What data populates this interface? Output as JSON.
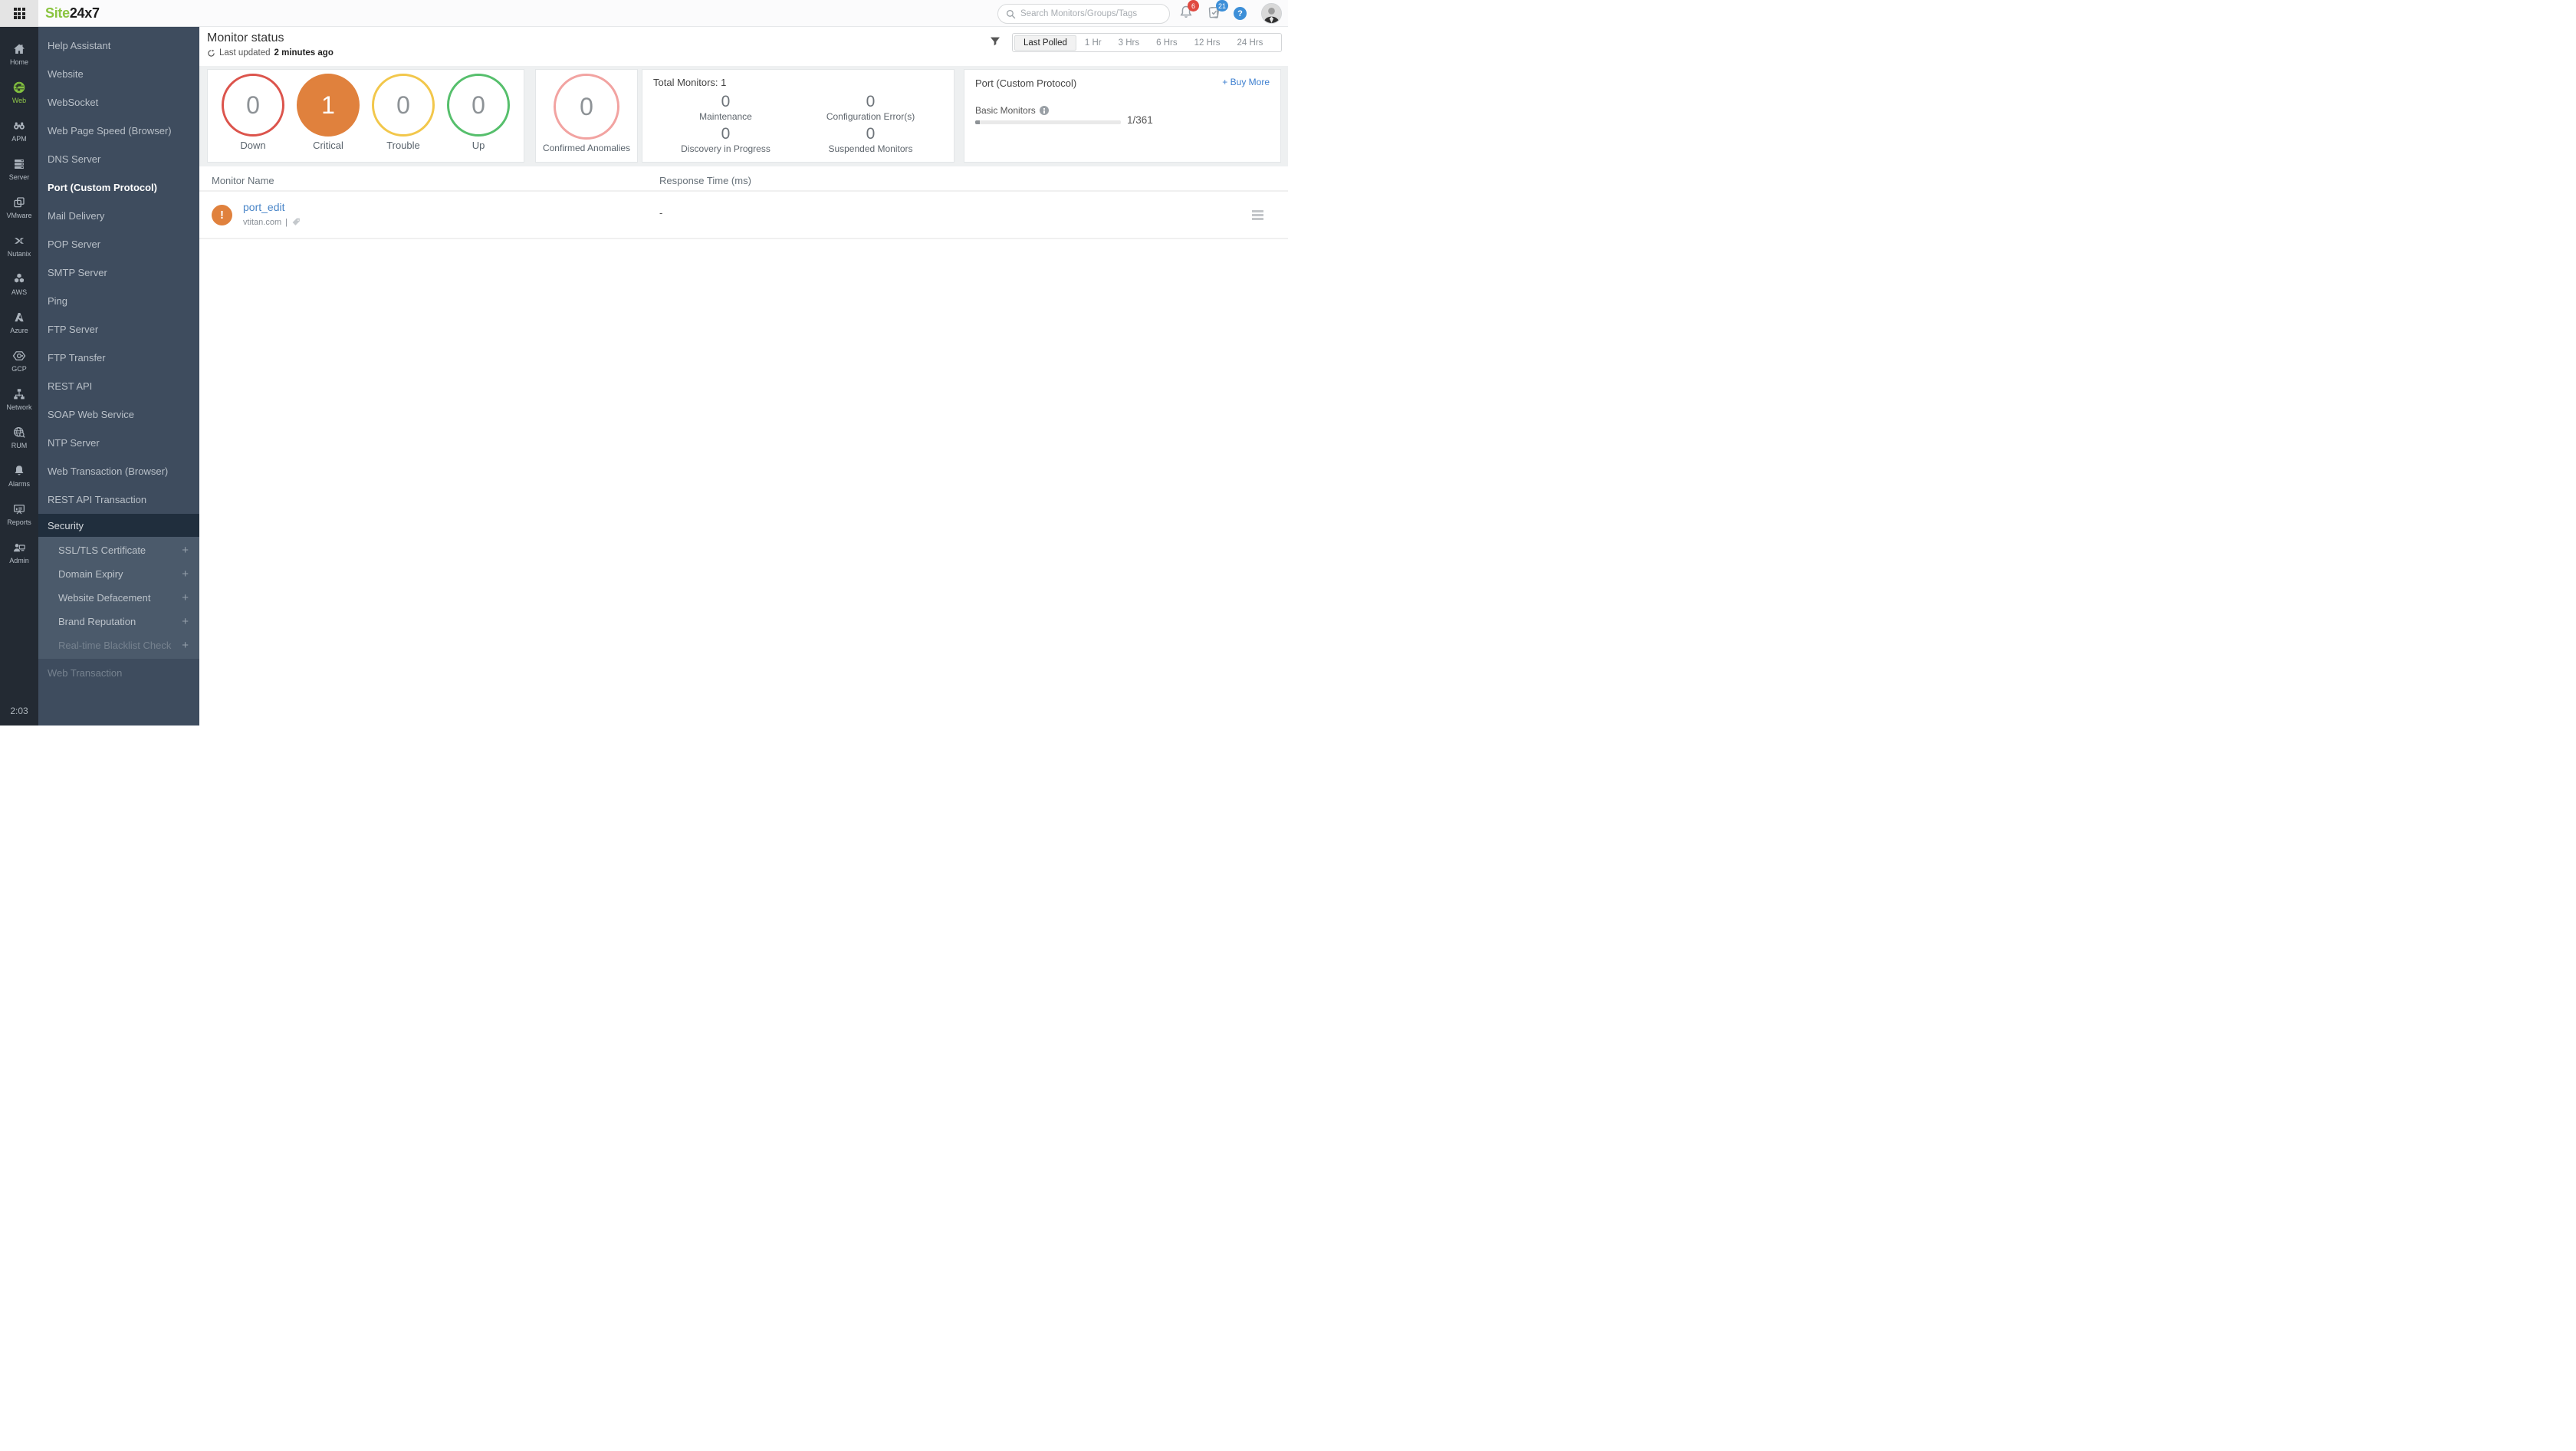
{
  "topbar": {
    "logo": {
      "part1": "Site",
      "part2": "24x7"
    },
    "search": {
      "placeholder": "Search Monitors/Groups/Tags"
    },
    "alerts_badge": "6",
    "tasks_badge": "21",
    "help_glyph": "?"
  },
  "rail": {
    "items": [
      {
        "label": "Home"
      },
      {
        "label": "Web"
      },
      {
        "label": "APM"
      },
      {
        "label": "Server"
      },
      {
        "label": "VMware"
      },
      {
        "label": "Nutanix"
      },
      {
        "label": "AWS"
      },
      {
        "label": "Azure"
      },
      {
        "label": "GCP"
      },
      {
        "label": "Network"
      },
      {
        "label": "RUM"
      },
      {
        "label": "Alarms"
      },
      {
        "label": "Reports"
      },
      {
        "label": "Admin"
      }
    ],
    "active_item": "Web",
    "clock": "2:03"
  },
  "sidebar": {
    "items": [
      "Help Assistant",
      "Website",
      "WebSocket",
      "Web Page Speed (Browser)",
      "DNS Server",
      "Port (Custom Protocol)",
      "Mail Delivery",
      "POP Server",
      "SMTP Server",
      "Ping",
      "FTP Server",
      "FTP Transfer",
      "REST API",
      "SOAP Web Service",
      "NTP Server",
      "Web Transaction (Browser)",
      "REST API Transaction"
    ],
    "active_item": "Port (Custom Protocol)",
    "security": {
      "header": "Security",
      "expand_glyph": "+",
      "items": [
        "SSL/TLS Certificate",
        "Domain Expiry",
        "Website Defacement",
        "Brand Reputation",
        "Real-time Blacklist Check"
      ],
      "disabled_items": [
        "Real-time Blacklist Check"
      ]
    },
    "footer_item": "Web Transaction"
  },
  "header": {
    "title": "Monitor status",
    "last_updated_label": "Last updated",
    "last_updated_value": "2 minutes ago"
  },
  "time_filter": {
    "options": [
      "Last Polled",
      "1 Hr",
      "3 Hrs",
      "6 Hrs",
      "12 Hrs",
      "24 Hrs"
    ],
    "active": "Last Polled"
  },
  "status_overview": {
    "statuses": [
      {
        "label": "Down",
        "count": "0"
      },
      {
        "label": "Critical",
        "count": "1"
      },
      {
        "label": "Trouble",
        "count": "0"
      },
      {
        "label": "Up",
        "count": "0"
      }
    ],
    "anomalies": {
      "label": "Confirmed Anomalies",
      "count": "0"
    }
  },
  "summary": {
    "total_label": "Total Monitors:",
    "total_value": "1",
    "stats": [
      {
        "value": "0",
        "label": "Maintenance"
      },
      {
        "value": "0",
        "label": "Configuration Error(s)"
      },
      {
        "value": "0",
        "label": "Discovery in Progress"
      },
      {
        "value": "0",
        "label": "Suspended Monitors"
      }
    ]
  },
  "license": {
    "title": "Port (Custom Protocol)",
    "buy_more": "+ Buy More",
    "meter_label": "Basic Monitors",
    "usage": "1/361",
    "progress_pct": 3
  },
  "table": {
    "columns": [
      "Monitor Name",
      "Response Time (ms)"
    ],
    "rows": [
      {
        "name": "port_edit",
        "host": "vtitan.com",
        "divider": "|",
        "response": "-",
        "status_glyph": "!"
      }
    ]
  },
  "colors": {
    "accent-green": "#8ac440",
    "down-red": "#dc544c",
    "critical-orange": "#e0813d",
    "trouble-yellow": "#f2c74b",
    "up-green": "#56bf6c",
    "anomaly-pink": "#f2a3a1",
    "link-blue": "#4a86c8",
    "badge-red": "#e04a41",
    "badge-blue": "#3d8fd8"
  }
}
